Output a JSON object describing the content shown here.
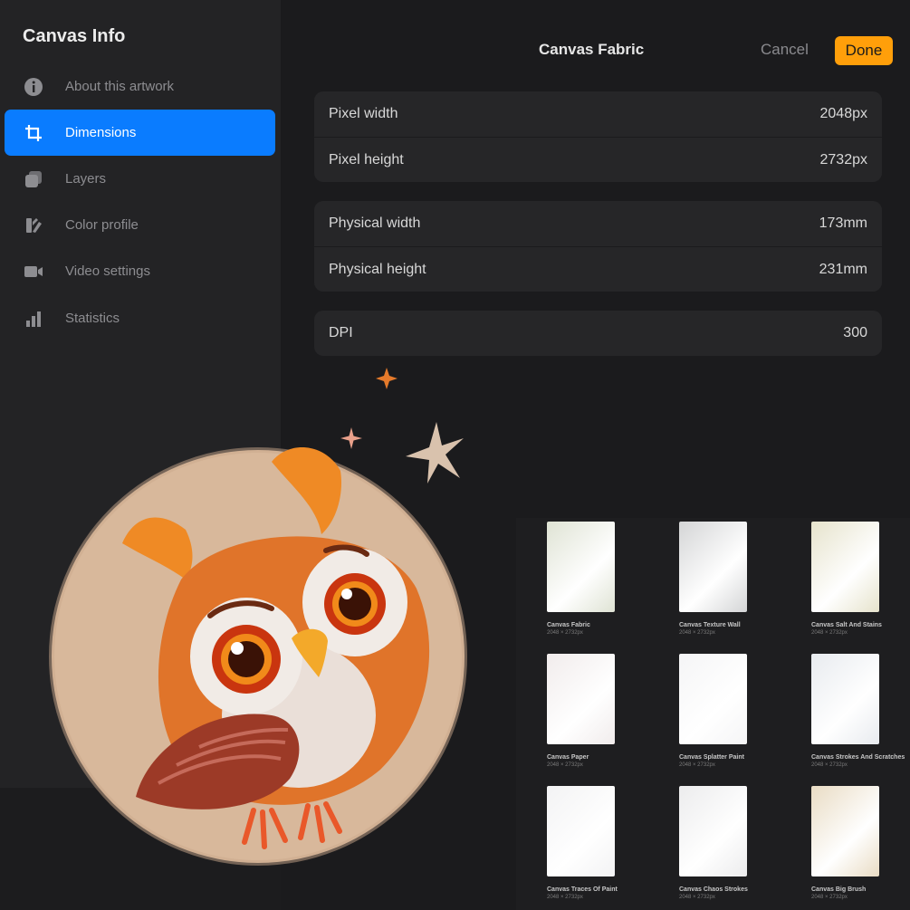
{
  "sidebar": {
    "title": "Canvas Info",
    "items": [
      {
        "label": "About this artwork",
        "icon": "info-icon"
      },
      {
        "label": "Dimensions",
        "icon": "crop-icon",
        "active": true
      },
      {
        "label": "Layers",
        "icon": "layers-icon"
      },
      {
        "label": "Color profile",
        "icon": "color-swatch-icon"
      },
      {
        "label": "Video settings",
        "icon": "video-camera-icon"
      },
      {
        "label": "Statistics",
        "icon": "bar-chart-icon"
      }
    ]
  },
  "header": {
    "title": "Canvas Fabric",
    "cancel_label": "Cancel",
    "done_label": "Done"
  },
  "dimensions": {
    "pixel": [
      {
        "label": "Pixel width",
        "value": "2048px"
      },
      {
        "label": "Pixel height",
        "value": "2732px"
      }
    ],
    "physical": [
      {
        "label": "Physical width",
        "value": "173mm"
      },
      {
        "label": "Physical height",
        "value": "231mm"
      }
    ],
    "dpi": {
      "label": "DPI",
      "value": "300"
    }
  },
  "canvases": [
    {
      "name": "Canvas Fabric",
      "size": "2048 × 2732px",
      "color": "#dfe3d4"
    },
    {
      "name": "Canvas Texture Wall",
      "size": "2048 × 2732px",
      "color": "#d4d5d6"
    },
    {
      "name": "Canvas Salt And Stains",
      "size": "2048 × 2732px",
      "color": "#e6e3cc"
    },
    {
      "name": "Canvas Paper",
      "size": "2048 × 2732px",
      "color": "#f1ecec"
    },
    {
      "name": "Canvas Splatter Paint",
      "size": "2048 × 2732px",
      "color": "#f5f5f6"
    },
    {
      "name": "Canvas Strokes And Scratches",
      "size": "2048 × 2732px",
      "color": "#e8ebef"
    },
    {
      "name": "Canvas Traces Of Paint",
      "size": "2048 × 2732px",
      "color": "#f3f3f4"
    },
    {
      "name": "Canvas Chaos Strokes",
      "size": "2048 × 2732px",
      "color": "#ececed"
    },
    {
      "name": "Canvas Big Brush",
      "size": "2048 × 2732px",
      "color": "#e9dcc4"
    }
  ],
  "colors": {
    "accent_blue": "#0a7cff",
    "done_orange": "#ff9f0a"
  }
}
